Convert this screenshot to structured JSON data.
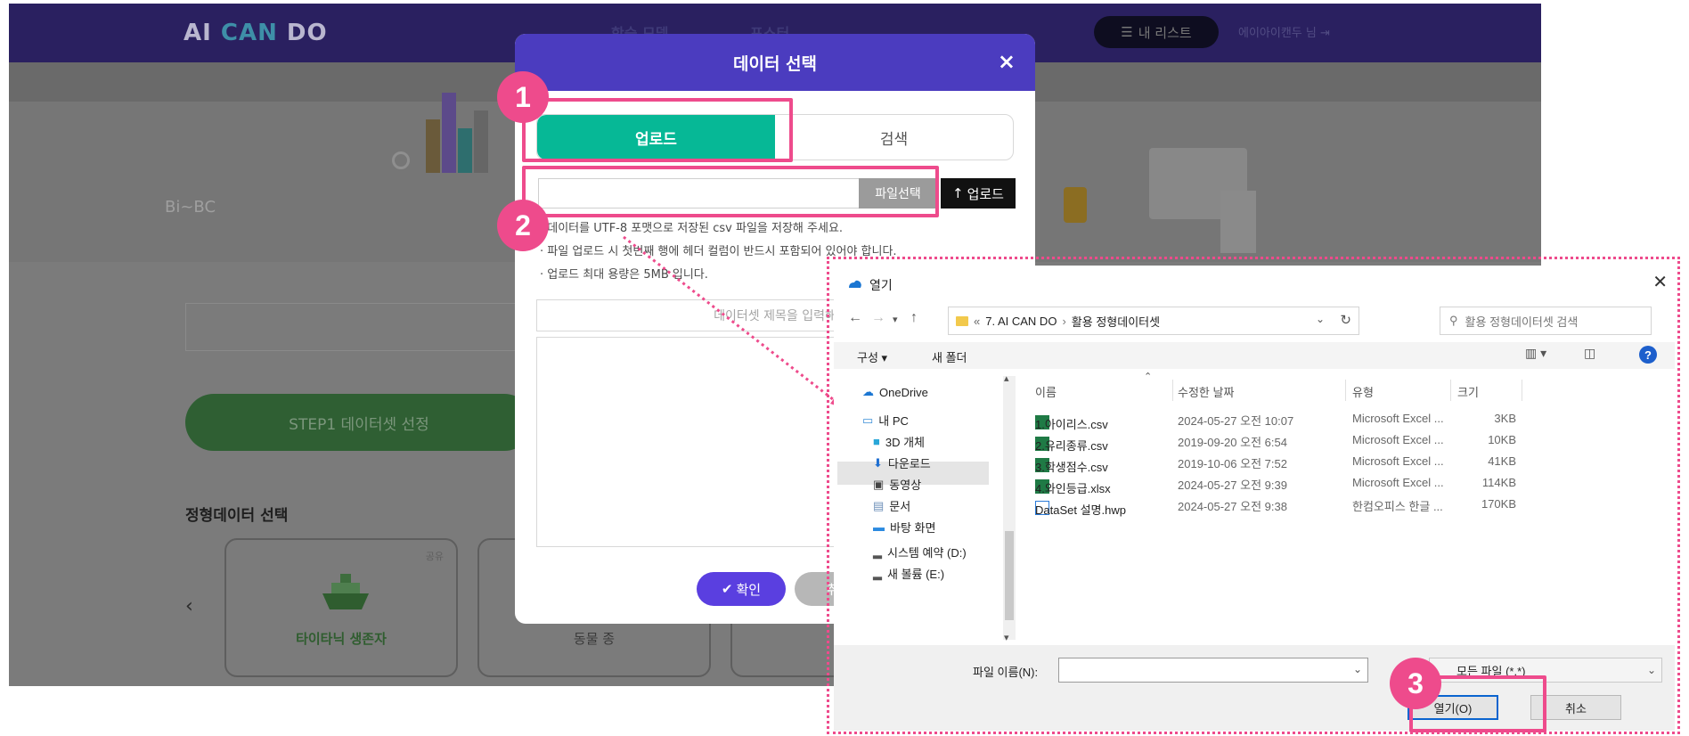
{
  "app": {
    "logo_prefix": "AI ",
    "logo_can": "CAN",
    "logo_suffix": " DO",
    "nav": [
      "학습 모델",
      "포스터"
    ],
    "mylist": "내 리스트",
    "user": "에이아이캔두 님",
    "hero_title": "Bi~BC",
    "step_button": "STEP1 데이터셋 선정",
    "section_title": "정형데이터 선택",
    "cards": [
      {
        "label": "타이타닉 생존자",
        "tag": "공유"
      },
      {
        "label": "동물 종",
        "tag": ""
      },
      {
        "label": "",
        "tag": ""
      }
    ]
  },
  "modal": {
    "title": "데이터 선택",
    "close": "×",
    "tabs": {
      "upload": "업로드",
      "search": "검색"
    },
    "choose_file": "파일선택",
    "upload_button": "업로드",
    "notes": [
      "· 데이터를 UTF-8 포맷으로 저장된 csv 파일을 저장해 주세요.",
      "· 파일 업로드 시 첫번째 행에 헤더 컬럼이 반드시 포함되어 있어야 합니다.",
      "· 업로드 최대 용량은 5MB 입니다."
    ],
    "title_placeholder": "데이터셋 제목을 입력해",
    "ok_button": "확인",
    "cancel_button": "취소"
  },
  "badges": [
    "1",
    "2",
    "3"
  ],
  "dialog": {
    "title": "열기",
    "close": "✕",
    "path": [
      "7. AI CAN DO",
      "활용 정형데이터셋"
    ],
    "search_placeholder": "활용 정형데이터셋 검색",
    "organize": "구성 ▾",
    "new_folder": "새 폴더",
    "tree": [
      "OneDrive",
      "내 PC",
      "3D 개체",
      "다운로드",
      "동영상",
      "문서",
      "바탕 화면",
      "시스템 예약 (D:)",
      "새 볼륨 (E:)"
    ],
    "columns": [
      "이름",
      "수정한 날짜",
      "유형",
      "크기"
    ],
    "files": [
      {
        "name": "1.아이리스.csv",
        "date": "2024-05-27 오전 10:07",
        "type": "Microsoft Excel ...",
        "size": "3KB",
        "icon": "excel-icon"
      },
      {
        "name": "2.유리종류.csv",
        "date": "2019-09-20 오전 6:54",
        "type": "Microsoft Excel ...",
        "size": "10KB",
        "icon": "excel-icon"
      },
      {
        "name": "3.학생점수.csv",
        "date": "2019-10-06 오전 7:52",
        "type": "Microsoft Excel ...",
        "size": "41KB",
        "icon": "excel-icon"
      },
      {
        "name": "4.와인등급.xlsx",
        "date": "2024-05-27 오전 9:39",
        "type": "Microsoft Excel ...",
        "size": "114KB",
        "icon": "excel-icon"
      },
      {
        "name": "DataSet 설명.hwp",
        "date": "2024-05-27 오전 9:38",
        "type": "한컴오피스 한글 ...",
        "size": "170KB",
        "icon": "hwp-icon"
      }
    ],
    "filename_label": "파일 이름(N):",
    "filename_value": "",
    "filetype": "모든 파일 (*.*)",
    "open_button": "열기(O)",
    "cancel_button": "취소"
  },
  "colors": {
    "accent_pink": "#ee4b8c",
    "modal_header": "#4b3cbf",
    "tab_active": "#06b896",
    "confirm": "#5a3fe0"
  }
}
